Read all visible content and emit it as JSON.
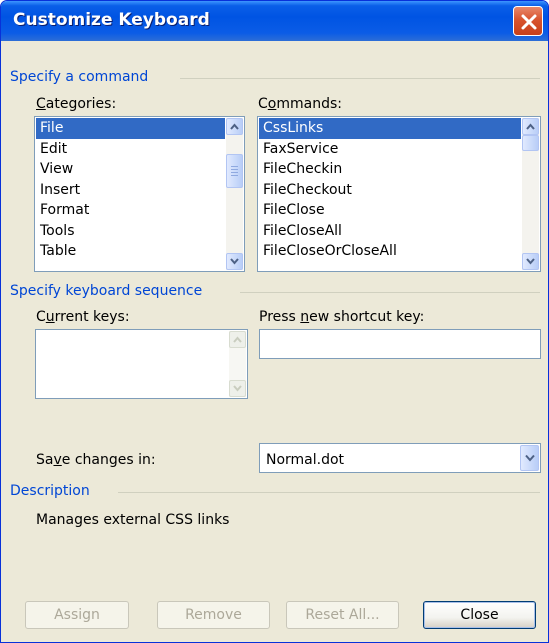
{
  "window": {
    "title": "Customize Keyboard"
  },
  "specify_command": {
    "group_label": "Specify a command",
    "categories_label": "Categories:",
    "categories": [
      "File",
      "Edit",
      "View",
      "Insert",
      "Format",
      "Tools",
      "Table"
    ],
    "categories_selected": "File",
    "commands_label": "Commands:",
    "commands": [
      "CssLinks",
      "FaxService",
      "FileCheckin",
      "FileCheckout",
      "FileClose",
      "FileCloseAll",
      "FileCloseOrCloseAll"
    ],
    "commands_selected": "CssLinks"
  },
  "keyboard_sequence": {
    "group_label": "Specify keyboard sequence",
    "current_keys_label": "Current keys:",
    "current_keys": [],
    "new_shortcut_label": "Press new shortcut key:",
    "new_shortcut_value": ""
  },
  "save_changes": {
    "label": "Save changes in:",
    "value": "Normal.dot"
  },
  "description": {
    "group_label": "Description",
    "text": "Manages external CSS links"
  },
  "buttons": {
    "assign": "Assign",
    "remove": "Remove",
    "reset_all": "Reset All...",
    "close": "Close"
  },
  "colors": {
    "title_bar": "#0054e3",
    "group_label": "#0046d5",
    "selection": "#316ac5",
    "dialog_bg": "#ece9d8"
  },
  "icons": {
    "close": "close-x-icon",
    "scroll_up": "chevron-up-icon",
    "scroll_down": "chevron-down-icon",
    "dropdown": "chevron-down-icon"
  }
}
